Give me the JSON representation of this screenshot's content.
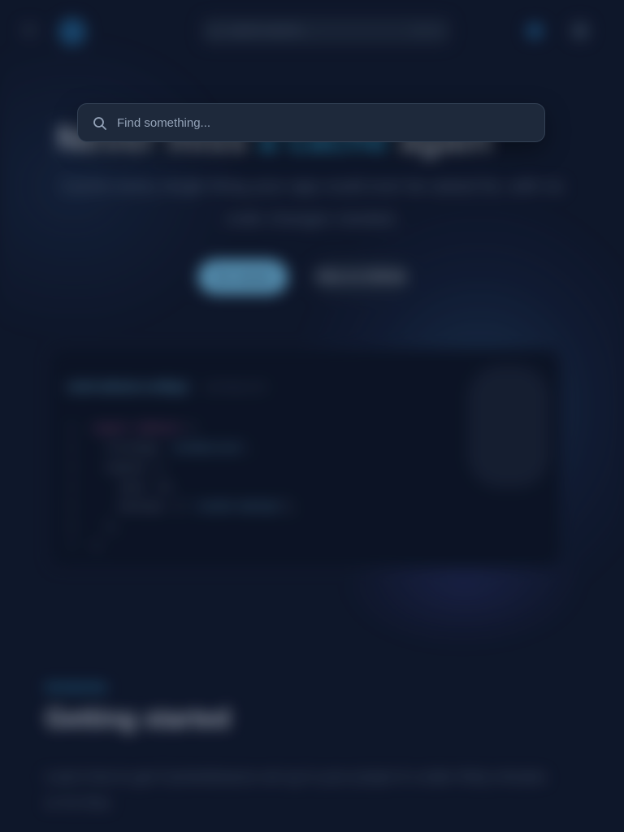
{
  "search": {
    "placeholder": "Find something..."
  },
  "colors": {
    "background": "#0f172a",
    "accent": "#38bdf8",
    "dialog": "#1e293b"
  },
  "icons": {
    "search": "search-icon"
  }
}
